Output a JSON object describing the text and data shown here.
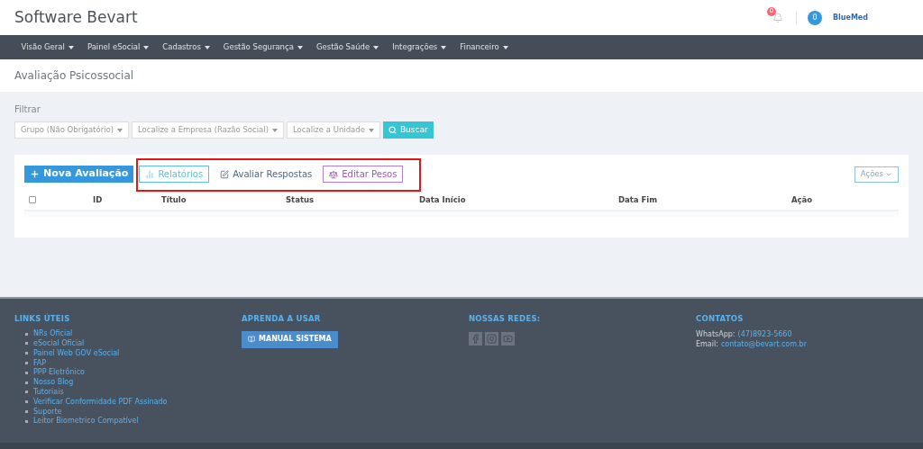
{
  "header": {
    "title": "Software Bevart",
    "notification_count": "0",
    "user_badge": "0",
    "logo": "BlueMed"
  },
  "nav": [
    "Visão Geral",
    "Painel eSocial",
    "Cadastros",
    "Gestão Segurança",
    "Gestão Saúde",
    "Integrações",
    "Financeiro"
  ],
  "page_title": "Avaliação Psicossocial",
  "filter": {
    "label": "Filtrar",
    "selects": [
      "Grupo (Não Obrigatório)",
      "Localize a Empresa (Razão Social)",
      "Localize a Unidade"
    ],
    "search_button": "Buscar"
  },
  "toolbar": {
    "buttons": [
      {
        "kind": "primary",
        "label": "Nova Avaliação"
      },
      {
        "kind": "info",
        "label": "Relatórios",
        "highlighted": true
      },
      {
        "kind": "link",
        "label": "Avaliar Respostas",
        "highlighted": true
      },
      {
        "kind": "purple",
        "label": "Editar Pesos",
        "highlighted": true
      }
    ],
    "actions": "Ações"
  },
  "table": {
    "select_all_checked": false,
    "columns": [
      "ID",
      "Título",
      "Status",
      "Data Início",
      "Data Fim",
      "Ação"
    ]
  },
  "footer": {
    "links_title": "LINKS ÚTEIS",
    "links": [
      "NRs Oficial",
      "eSocial Oficial",
      "Painel Web GOV eSocial",
      "FAP",
      "PPP Eletrônico",
      "Nosso Blog",
      "Tutoriais",
      "Verificar Conformidade PDF Assinado",
      "Suporte",
      "Leitor Biometrico Compatível"
    ],
    "learn_title": "APRENDA A USAR",
    "manual_button": "MANUAL SISTEMA",
    "social_title": "NOSSAS REDES:",
    "social": [
      {
        "kind": "facebook"
      },
      {
        "kind": "instagram"
      },
      {
        "kind": "youtube"
      }
    ],
    "contacts_title": "CONTATOS",
    "contacts": [
      {
        "label": "WhatsApp:",
        "value": "(47)8923-5660"
      },
      {
        "label": "Email:",
        "value": "contato@bevart.com.br"
      }
    ]
  }
}
